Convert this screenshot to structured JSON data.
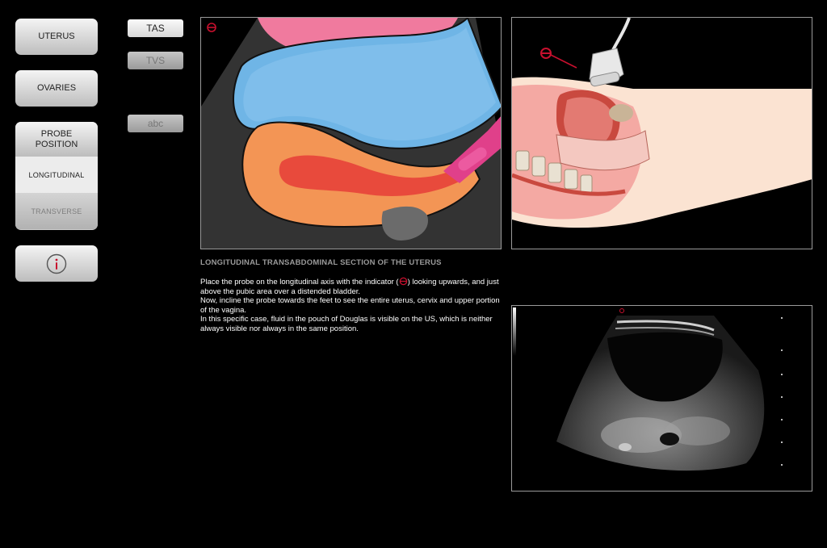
{
  "nav": {
    "uterus": "UTERUS",
    "ovaries": "OVARIES",
    "probe_position": "PROBE\nPOSITION",
    "longitudinal": "LONGITUDINAL",
    "transverse": "TRANSVERSE",
    "info_icon": "info-icon"
  },
  "modes": {
    "tas": "TAS",
    "tvs": "TVS",
    "abc": "abc"
  },
  "section": {
    "title": "LONGITUDINAL TRANSABDOMINAL SECTION OF THE UTERUS",
    "line1a": "Place the probe on the longitudinal axis with the indicator (",
    "line1b": ") looking upwards, and just above the pubic area over a distended bladder.",
    "line2": "Now, incline the probe towards the feet to see the entire uterus, cervix and upper portion of the vagina.",
    "line3": "In this specific case, fluid in the pouch of Douglas is visible on the US, which is neither always visible nor always in the same position."
  },
  "colors": {
    "indicator": "#c8102e",
    "bladder": "#5aa9e0",
    "uterus": "#f08a4b",
    "probe": "#e0408a",
    "skin": "#fbe3d2"
  }
}
